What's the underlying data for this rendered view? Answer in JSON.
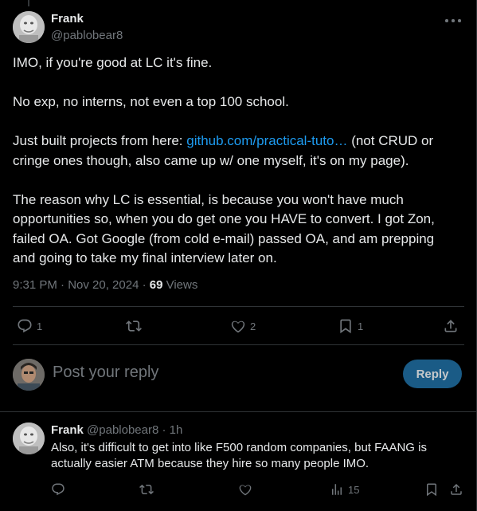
{
  "tweet": {
    "author_name": "Frank",
    "author_handle": "@pablobear8",
    "paragraphs": {
      "p1": "IMO, if you're good at LC it's fine.",
      "p2": "No exp, no interns, not even a top 100 school.",
      "p3_before": "Just built projects from here: ",
      "p3_link": "github.com/practical-tuto…",
      "p3_after": " (not CRUD or cringe ones though, also came up w/ one myself, it's on my page).",
      "p4": "The reason why LC is essential, is because you won't have much opportunities so, when you do get one you HAVE to convert. I got Zon, failed OA. Got Google (from cold e-mail) passed OA, and am prepping and going to take my final interview later on."
    },
    "timestamp": "9:31 PM · Nov 20, 2024 · ",
    "views_count": "69",
    "views_label": " Views",
    "actions": {
      "reply_count": "1",
      "retweet_count": "",
      "like_count": "2",
      "bookmark_count": "1"
    }
  },
  "compose": {
    "placeholder": "Post your reply",
    "reply_button": "Reply"
  },
  "reply": {
    "author_name": "Frank",
    "author_handle": " @pablobear8 · 1h",
    "text": "Also, it's difficult to get into like F500 random companies, but FAANG is actually easier ATM because they hire so many people IMO.",
    "views_count": "15"
  },
  "colors": {
    "background": "#000000",
    "text": "#e7e9ea",
    "muted": "#71767b",
    "link": "#1d9bf0",
    "border": "#2f3336",
    "reply_button": "#1a5b86"
  },
  "icons": [
    "more-icon",
    "reply-icon",
    "retweet-icon",
    "like-icon",
    "bookmark-icon",
    "share-icon",
    "views-icon"
  ]
}
